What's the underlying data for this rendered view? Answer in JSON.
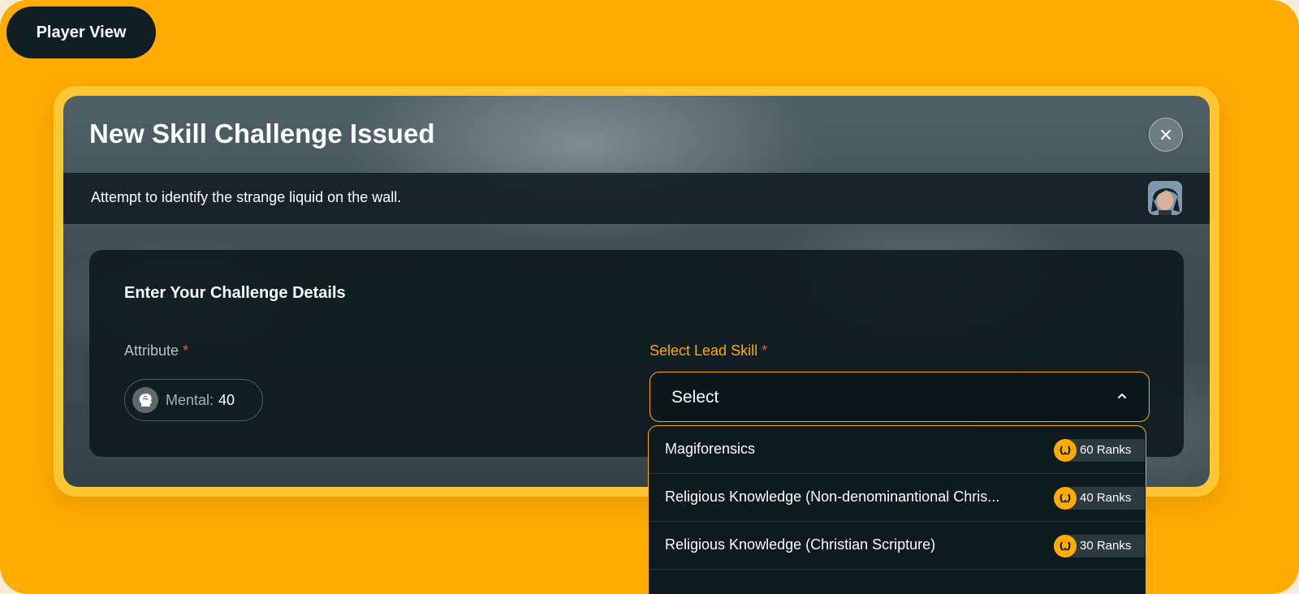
{
  "header": {
    "view_button": "Player View"
  },
  "modal": {
    "title": "New Skill Challenge Issued",
    "close_icon": "close-icon",
    "description": "Attempt to identify the strange liquid on the wall.",
    "panel": {
      "title": "Enter Your Challenge Details",
      "attribute_label": "Attribute",
      "required_mark": "*",
      "attribute_chip": {
        "icon": "brain-head-icon",
        "label": "Mental:",
        "value": "40"
      },
      "lead_skill_label": "Select Lead Skill",
      "lead_skill_select": {
        "value": "Select",
        "icon": "chevron-up-icon"
      }
    }
  },
  "dropdown": {
    "options": [
      {
        "label": "Magiforensics",
        "ranks": "60 Ranks"
      },
      {
        "label": "Religious Knowledge (Non-denominantional Chris...",
        "ranks": "40 Ranks"
      },
      {
        "label": "Religious Knowledge (Christian Scripture)",
        "ranks": "30 Ranks"
      }
    ],
    "rank_icon": "laurel-icon"
  },
  "colors": {
    "accent": "#ffab00",
    "required": "#ff4d3d",
    "dark": "#0f1f24"
  }
}
